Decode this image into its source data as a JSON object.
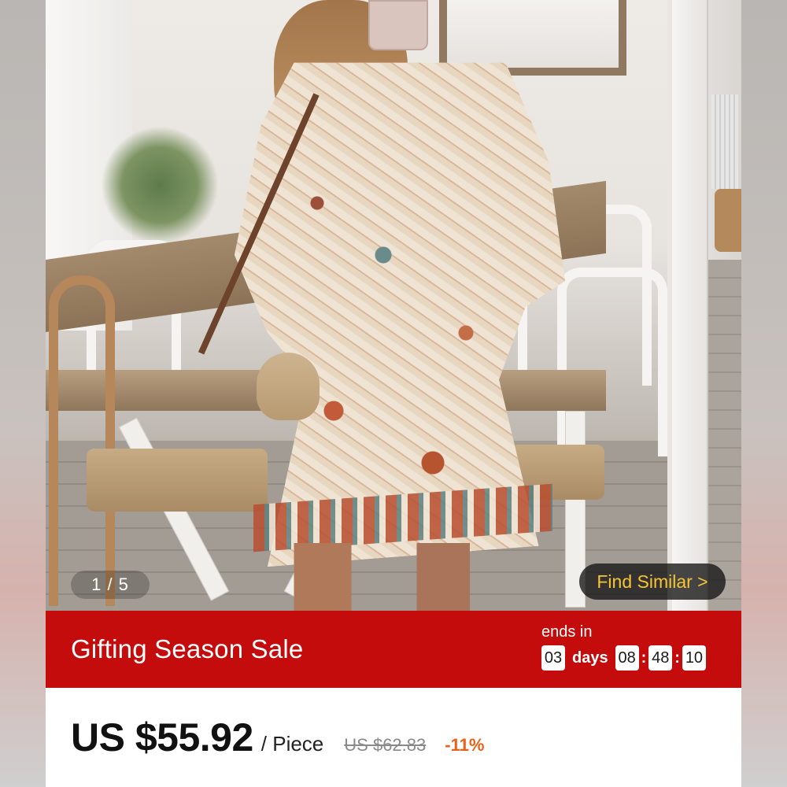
{
  "gallery": {
    "current_page": 1,
    "total_pages": 5,
    "page_indicator": "1 / 5",
    "find_similar_label": "Find Similar >"
  },
  "sale": {
    "title": "Gifting Season Sale",
    "ends_in_label": "ends in",
    "countdown": {
      "days": "03",
      "days_label": "days",
      "hours": "08",
      "minutes": "48",
      "seconds": "10",
      "separator": ":"
    },
    "banner_color": "#c40c0c"
  },
  "price": {
    "current": "US $55.92",
    "unit": "/ Piece",
    "original": "US $62.83",
    "discount": "-11%",
    "discount_color": "#e8611a"
  },
  "accent": {
    "find_similar_text_color": "#f7c437"
  }
}
